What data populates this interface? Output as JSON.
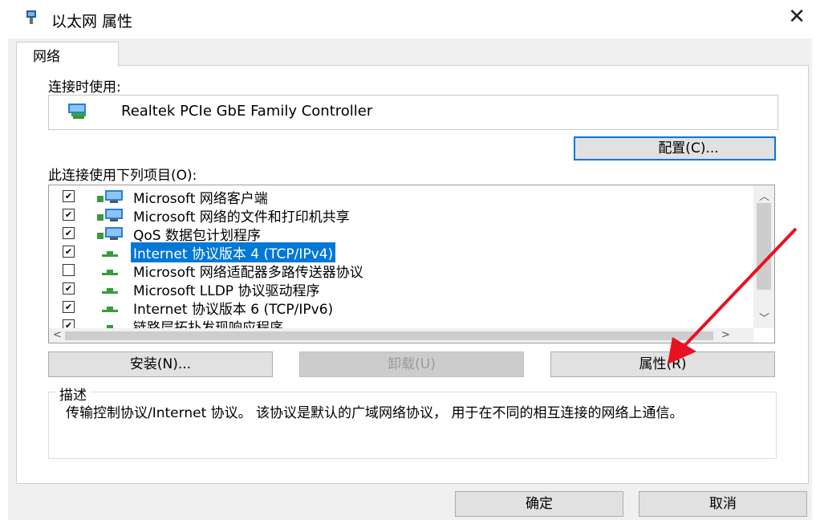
{
  "window": {
    "title": "以太网 属性",
    "close_icon": "close-icon"
  },
  "tabs": [
    {
      "label": "网络"
    }
  ],
  "connect_using": {
    "label": "连接时使用:",
    "adapter_name": "Realtek PCIe GbE Family Controller",
    "configure_button": "配置(C)..."
  },
  "items_list": {
    "label": "此连接使用下列项目(O):",
    "items": [
      {
        "label": "Microsoft 网络客户端",
        "checked": true,
        "icon": "network-client-icon"
      },
      {
        "label": "Microsoft 网络的文件和打印机共享",
        "checked": true,
        "icon": "network-share-icon"
      },
      {
        "label": "QoS 数据包计划程序",
        "checked": true,
        "icon": "network-service-icon"
      },
      {
        "label": "Internet 协议版本 4 (TCP/IPv4)",
        "checked": true,
        "selected": true,
        "icon": "protocol-icon"
      },
      {
        "label": "Microsoft 网络适配器多路传送器协议",
        "checked": false,
        "icon": "protocol-icon"
      },
      {
        "label": "Microsoft LLDP 协议驱动程序",
        "checked": true,
        "icon": "protocol-icon"
      },
      {
        "label": "Internet 协议版本 6 (TCP/IPv6)",
        "checked": true,
        "icon": "protocol-icon"
      },
      {
        "label": "链路层拓扑发现响应程序",
        "checked": true,
        "icon": "protocol-icon"
      }
    ]
  },
  "buttons": {
    "install": "安装(N)...",
    "uninstall": "卸载(U)",
    "properties": "属性(R)",
    "ok": "确定",
    "cancel": "取消"
  },
  "description": {
    "title": "描述",
    "text": "传输控制协议/Internet 协议。 该协议是默认的广域网络协议， 用于在不同的相互连接的网络上通信。"
  },
  "annotation": {
    "arrow_color": "#e81123"
  },
  "colors": {
    "selection": "#0078d7",
    "focus_border": "#0078d7"
  }
}
